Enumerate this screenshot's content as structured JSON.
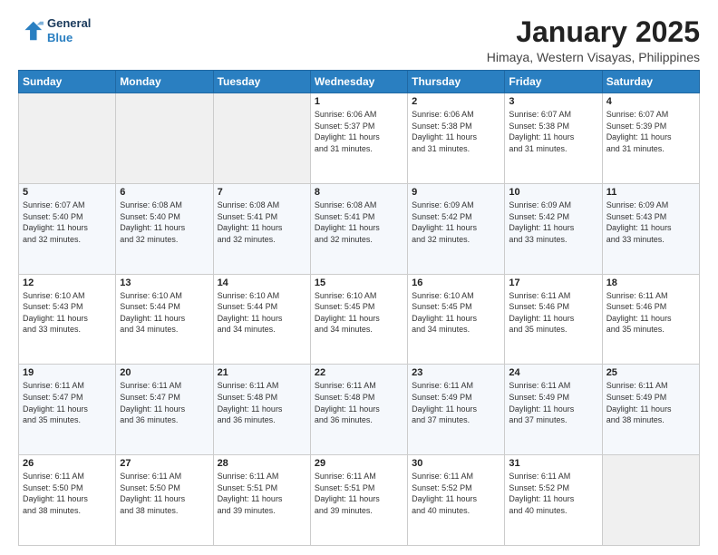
{
  "logo": {
    "line1": "General",
    "line2": "Blue"
  },
  "title": "January 2025",
  "location": "Himaya, Western Visayas, Philippines",
  "days_of_week": [
    "Sunday",
    "Monday",
    "Tuesday",
    "Wednesday",
    "Thursday",
    "Friday",
    "Saturday"
  ],
  "weeks": [
    [
      {
        "num": "",
        "info": ""
      },
      {
        "num": "",
        "info": ""
      },
      {
        "num": "",
        "info": ""
      },
      {
        "num": "1",
        "info": "Sunrise: 6:06 AM\nSunset: 5:37 PM\nDaylight: 11 hours\nand 31 minutes."
      },
      {
        "num": "2",
        "info": "Sunrise: 6:06 AM\nSunset: 5:38 PM\nDaylight: 11 hours\nand 31 minutes."
      },
      {
        "num": "3",
        "info": "Sunrise: 6:07 AM\nSunset: 5:38 PM\nDaylight: 11 hours\nand 31 minutes."
      },
      {
        "num": "4",
        "info": "Sunrise: 6:07 AM\nSunset: 5:39 PM\nDaylight: 11 hours\nand 31 minutes."
      }
    ],
    [
      {
        "num": "5",
        "info": "Sunrise: 6:07 AM\nSunset: 5:40 PM\nDaylight: 11 hours\nand 32 minutes."
      },
      {
        "num": "6",
        "info": "Sunrise: 6:08 AM\nSunset: 5:40 PM\nDaylight: 11 hours\nand 32 minutes."
      },
      {
        "num": "7",
        "info": "Sunrise: 6:08 AM\nSunset: 5:41 PM\nDaylight: 11 hours\nand 32 minutes."
      },
      {
        "num": "8",
        "info": "Sunrise: 6:08 AM\nSunset: 5:41 PM\nDaylight: 11 hours\nand 32 minutes."
      },
      {
        "num": "9",
        "info": "Sunrise: 6:09 AM\nSunset: 5:42 PM\nDaylight: 11 hours\nand 32 minutes."
      },
      {
        "num": "10",
        "info": "Sunrise: 6:09 AM\nSunset: 5:42 PM\nDaylight: 11 hours\nand 33 minutes."
      },
      {
        "num": "11",
        "info": "Sunrise: 6:09 AM\nSunset: 5:43 PM\nDaylight: 11 hours\nand 33 minutes."
      }
    ],
    [
      {
        "num": "12",
        "info": "Sunrise: 6:10 AM\nSunset: 5:43 PM\nDaylight: 11 hours\nand 33 minutes."
      },
      {
        "num": "13",
        "info": "Sunrise: 6:10 AM\nSunset: 5:44 PM\nDaylight: 11 hours\nand 34 minutes."
      },
      {
        "num": "14",
        "info": "Sunrise: 6:10 AM\nSunset: 5:44 PM\nDaylight: 11 hours\nand 34 minutes."
      },
      {
        "num": "15",
        "info": "Sunrise: 6:10 AM\nSunset: 5:45 PM\nDaylight: 11 hours\nand 34 minutes."
      },
      {
        "num": "16",
        "info": "Sunrise: 6:10 AM\nSunset: 5:45 PM\nDaylight: 11 hours\nand 34 minutes."
      },
      {
        "num": "17",
        "info": "Sunrise: 6:11 AM\nSunset: 5:46 PM\nDaylight: 11 hours\nand 35 minutes."
      },
      {
        "num": "18",
        "info": "Sunrise: 6:11 AM\nSunset: 5:46 PM\nDaylight: 11 hours\nand 35 minutes."
      }
    ],
    [
      {
        "num": "19",
        "info": "Sunrise: 6:11 AM\nSunset: 5:47 PM\nDaylight: 11 hours\nand 35 minutes."
      },
      {
        "num": "20",
        "info": "Sunrise: 6:11 AM\nSunset: 5:47 PM\nDaylight: 11 hours\nand 36 minutes."
      },
      {
        "num": "21",
        "info": "Sunrise: 6:11 AM\nSunset: 5:48 PM\nDaylight: 11 hours\nand 36 minutes."
      },
      {
        "num": "22",
        "info": "Sunrise: 6:11 AM\nSunset: 5:48 PM\nDaylight: 11 hours\nand 36 minutes."
      },
      {
        "num": "23",
        "info": "Sunrise: 6:11 AM\nSunset: 5:49 PM\nDaylight: 11 hours\nand 37 minutes."
      },
      {
        "num": "24",
        "info": "Sunrise: 6:11 AM\nSunset: 5:49 PM\nDaylight: 11 hours\nand 37 minutes."
      },
      {
        "num": "25",
        "info": "Sunrise: 6:11 AM\nSunset: 5:49 PM\nDaylight: 11 hours\nand 38 minutes."
      }
    ],
    [
      {
        "num": "26",
        "info": "Sunrise: 6:11 AM\nSunset: 5:50 PM\nDaylight: 11 hours\nand 38 minutes."
      },
      {
        "num": "27",
        "info": "Sunrise: 6:11 AM\nSunset: 5:50 PM\nDaylight: 11 hours\nand 38 minutes."
      },
      {
        "num": "28",
        "info": "Sunrise: 6:11 AM\nSunset: 5:51 PM\nDaylight: 11 hours\nand 39 minutes."
      },
      {
        "num": "29",
        "info": "Sunrise: 6:11 AM\nSunset: 5:51 PM\nDaylight: 11 hours\nand 39 minutes."
      },
      {
        "num": "30",
        "info": "Sunrise: 6:11 AM\nSunset: 5:52 PM\nDaylight: 11 hours\nand 40 minutes."
      },
      {
        "num": "31",
        "info": "Sunrise: 6:11 AM\nSunset: 5:52 PM\nDaylight: 11 hours\nand 40 minutes."
      },
      {
        "num": "",
        "info": ""
      }
    ]
  ]
}
